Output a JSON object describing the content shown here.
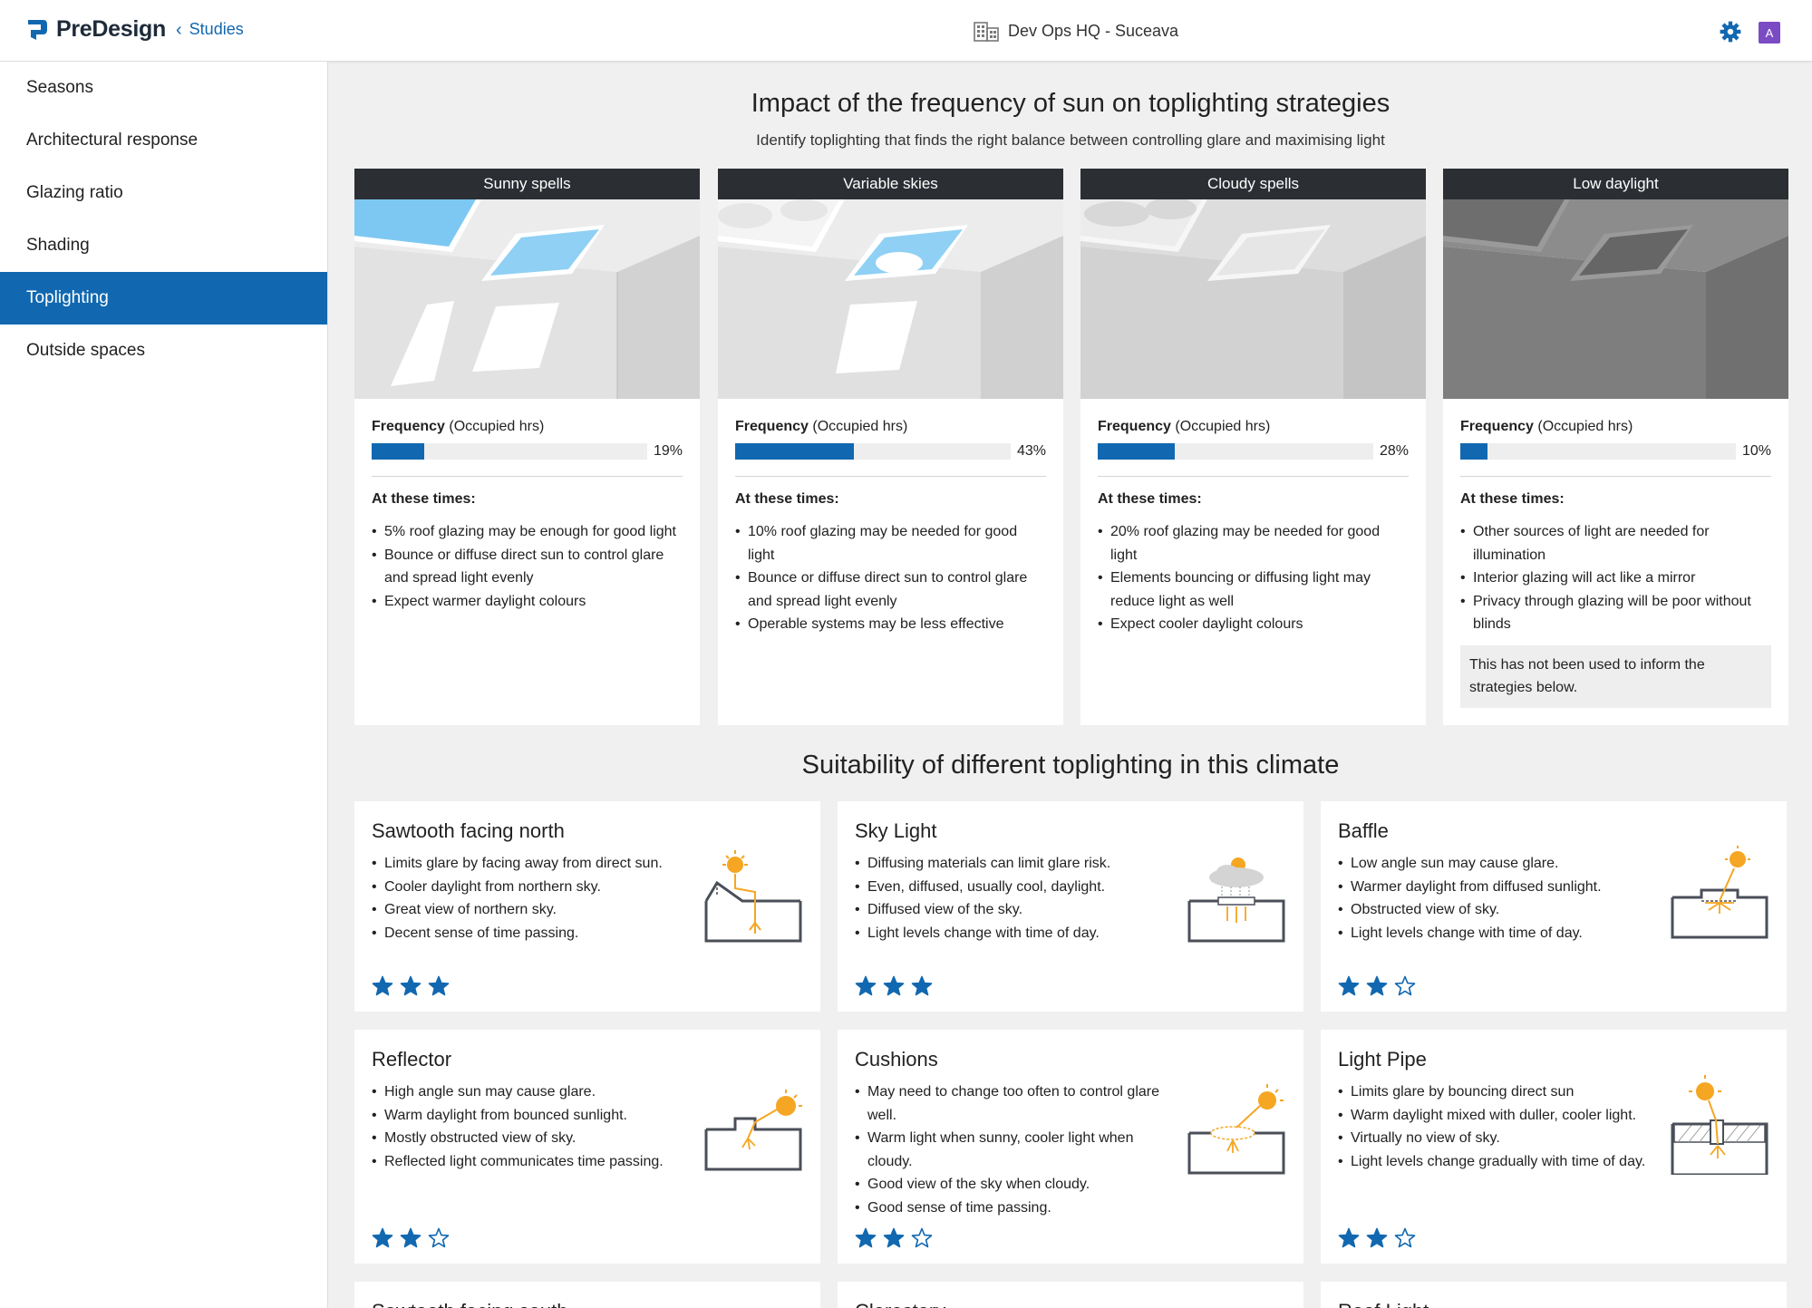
{
  "app": {
    "name": "PreDesign",
    "back_label": "Studies",
    "project_name": "Dev Ops HQ - Suceava",
    "avatar_letter": "A"
  },
  "colors": {
    "accent": "#1168b0",
    "header_dark": "#2b2e33",
    "sun": "#f5a623"
  },
  "sidebar": {
    "items": [
      {
        "label": "Seasons"
      },
      {
        "label": "Architectural response"
      },
      {
        "label": "Glazing ratio"
      },
      {
        "label": "Shading"
      },
      {
        "label": "Toplighting",
        "active": true
      },
      {
        "label": "Outside spaces"
      }
    ]
  },
  "main": {
    "title": "Impact of the frequency of sun on toplighting strategies",
    "subtitle": "Identify toplighting that finds the right balance between controlling glare and maximising light",
    "freq_label": "Frequency",
    "freq_unit": " (Occupied hrs)",
    "times_label": "At these times:",
    "weather": [
      {
        "title": "Sunny spells",
        "percent": 19,
        "percent_label": "19%",
        "bullets": [
          "5% roof glazing may be enough for good light",
          "Bounce or diffuse direct sun to control glare and spread light evenly",
          "Expect warmer daylight colours"
        ]
      },
      {
        "title": "Variable skies",
        "percent": 43,
        "percent_label": "43%",
        "bullets": [
          "10% roof glazing may be needed for good light",
          "Bounce or diffuse direct sun to control glare and spread light evenly",
          "Operable systems may be less effective"
        ]
      },
      {
        "title": "Cloudy spells",
        "percent": 28,
        "percent_label": "28%",
        "bullets": [
          "20% roof glazing may be needed for good light",
          "Elements bouncing or diffusing light may reduce light as well",
          "Expect cooler daylight colours"
        ]
      },
      {
        "title": "Low daylight",
        "percent": 10,
        "percent_label": "10%",
        "bullets": [
          "Other sources of light are needed for illumination",
          "Interior glazing will act like a mirror",
          "Privacy through glazing will be poor without blinds"
        ],
        "note": "This has not been used to inform the strategies below."
      }
    ],
    "suitability_title": "Suitability of different toplighting in this climate",
    "strategies": [
      {
        "title": "Sawtooth facing north",
        "rating": 3,
        "bullets": [
          "Limits glare by facing away from direct sun.",
          "Cooler daylight from northern sky.",
          "Great view of northern sky.",
          "Decent sense of time passing."
        ]
      },
      {
        "title": "Sky Light",
        "rating": 3,
        "bullets": [
          "Diffusing materials can limit glare risk.",
          "Even, diffused, usually cool, daylight.",
          "Diffused view of the sky.",
          "Light levels change with time of day."
        ]
      },
      {
        "title": "Baffle",
        "rating": 2,
        "bullets": [
          "Low angle sun may cause glare.",
          "Warmer daylight from diffused sunlight.",
          "Obstructed view of sky.",
          "Light levels change with time of day."
        ]
      },
      {
        "title": "Reflector",
        "rating": 2,
        "bullets": [
          "High angle sun may cause glare.",
          "Warm daylight from bounced sunlight.",
          "Mostly obstructed view of sky.",
          "Reflected light communicates time passing."
        ]
      },
      {
        "title": "Cushions",
        "rating": 2,
        "bullets": [
          "May need to change too often to control glare well.",
          "Warm light when sunny, cooler light when cloudy.",
          "Good view of the sky when cloudy.",
          "Good sense of time passing."
        ]
      },
      {
        "title": "Light Pipe",
        "rating": 2,
        "bullets": [
          "Limits glare by bouncing direct sun",
          "Warm daylight mixed with duller, cooler light.",
          "Virtually no view of sky.",
          "Light levels change gradually with time of day."
        ]
      },
      {
        "title": "Sawtooth facing south"
      },
      {
        "title": "Clerestory"
      },
      {
        "title": "Roof Light"
      }
    ]
  }
}
